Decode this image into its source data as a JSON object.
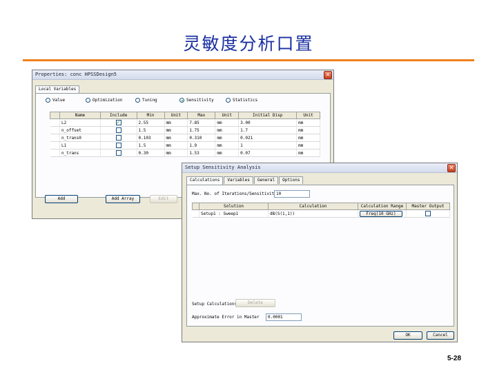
{
  "slide": {
    "title": "灵敏度分析口置",
    "page_number": "5-28"
  },
  "colors": {
    "title": "#1a2fa0",
    "rule": "#ee7f1b"
  },
  "properties_window": {
    "title": "Properties: conc   HPSSDesign5",
    "tab_label": "Local Variables",
    "analysis_options": [
      {
        "label": "Value",
        "selected": false
      },
      {
        "label": "Optimization",
        "selected": false
      },
      {
        "label": "Tuning",
        "selected": false
      },
      {
        "label": "Sensitivity",
        "selected": true
      },
      {
        "label": "Statistics",
        "selected": false
      }
    ],
    "columns": [
      "Name",
      "Include",
      "Min",
      "Unit",
      "Max",
      "Unit",
      "Initial Disp",
      "Unit"
    ],
    "rows": [
      {
        "name": "L2",
        "include": true,
        "min": "2.55",
        "unit1": "mm",
        "max": "7.85",
        "unit2": "mm",
        "initial": "3.00",
        "unit3": "mm"
      },
      {
        "name": "n_offset",
        "include": false,
        "min": "1.5",
        "unit1": "mm",
        "max": "1.75",
        "unit2": "mm",
        "initial": "1.7",
        "unit3": "mm"
      },
      {
        "name": "n_trans0",
        "include": false,
        "min": "0.103",
        "unit1": "mm",
        "max": "0.310",
        "unit2": "mm",
        "initial": "0.021",
        "unit3": "mm"
      },
      {
        "name": "L1",
        "include": false,
        "min": "1.5",
        "unit1": "mm",
        "max": "1.9",
        "unit2": "mm",
        "initial": "1",
        "unit3": "mm"
      },
      {
        "name": "n_trans",
        "include": false,
        "min": "0.30",
        "unit1": "mm",
        "max": "1.53",
        "unit2": "mm",
        "initial": "0.07",
        "unit3": "mm"
      }
    ],
    "buttons": {
      "add": "Add",
      "add_array": "Add Array",
      "edit": "Edit"
    }
  },
  "setup_window": {
    "title": "Setup Sensitivity Analysis",
    "tabs": [
      "Calculations",
      "Variables",
      "General",
      "Options"
    ],
    "iterations_label": "Max. No. of Iterations/Sensitivity",
    "iterations_value": "10",
    "columns": [
      "Solution",
      "Calculation",
      "Calculation Range",
      "Master Output"
    ],
    "rows": [
      {
        "solution": "Setup1 : Sweep1",
        "calculation": "dB(S(1,1))",
        "range": "Freq(10 GHz)",
        "master_output": false
      }
    ],
    "setup_calc_button": "Setup Calculations",
    "delete_button": "Delete",
    "approx_label": "Approximate Error in Master",
    "approx_value": "0.0001",
    "ok_button": "OK",
    "cancel_button": "Cancel"
  }
}
